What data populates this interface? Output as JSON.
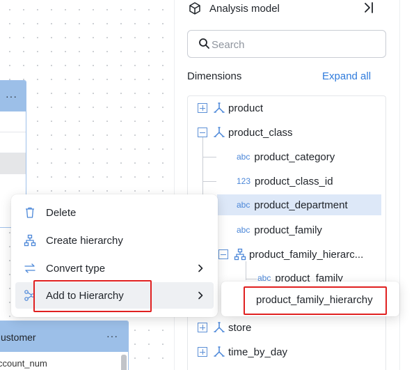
{
  "canvas": {
    "card_top": {
      "menu_dots": "···"
    },
    "card_customer": {
      "title": "ustomer",
      "menu_dots": "···",
      "row_text": "ccount_num"
    }
  },
  "panel": {
    "title": "Analysis model",
    "title_icon": "cube-icon",
    "collapse_icon": "collapse-right-icon",
    "search": {
      "placeholder": "Search",
      "value": ""
    },
    "dimensions_label": "Dimensions",
    "expand_all": "Expand all",
    "tree": [
      {
        "label": "product",
        "kind": "dimension",
        "expanded": false
      },
      {
        "label": "product_class",
        "kind": "dimension",
        "expanded": true
      },
      {
        "label": "product_category",
        "kind": "field",
        "type": "abc"
      },
      {
        "label": "product_class_id",
        "kind": "field",
        "type": "123"
      },
      {
        "label": "product_department",
        "kind": "field",
        "type": "abc",
        "selected": true
      },
      {
        "label": "product_family",
        "kind": "field",
        "type": "abc"
      },
      {
        "label": "product_family_hierarc...",
        "kind": "hierarchy",
        "expanded": true
      },
      {
        "label": "product_family",
        "kind": "field",
        "type": "abc"
      },
      {
        "label": "store",
        "kind": "dimension",
        "expanded": false
      },
      {
        "label": "time_by_day",
        "kind": "dimension",
        "expanded": false
      }
    ]
  },
  "context_menu": {
    "items": [
      {
        "label": "Delete",
        "icon": "trash-icon",
        "submenu": false
      },
      {
        "label": "Create hierarchy",
        "icon": "hierarchy-icon",
        "submenu": false
      },
      {
        "label": "Convert type",
        "icon": "convert-icon",
        "submenu": true
      },
      {
        "label": "Add to Hierarchy",
        "icon": "add-hierarchy-icon",
        "submenu": true,
        "hovered": true
      }
    ],
    "submenu_items": [
      "product_family_hierarchy"
    ]
  },
  "colors": {
    "accent": "#2f7bdc",
    "highlight": "#dde8f8",
    "annotation": "#e02020",
    "table_header": "#9cbfe8"
  }
}
